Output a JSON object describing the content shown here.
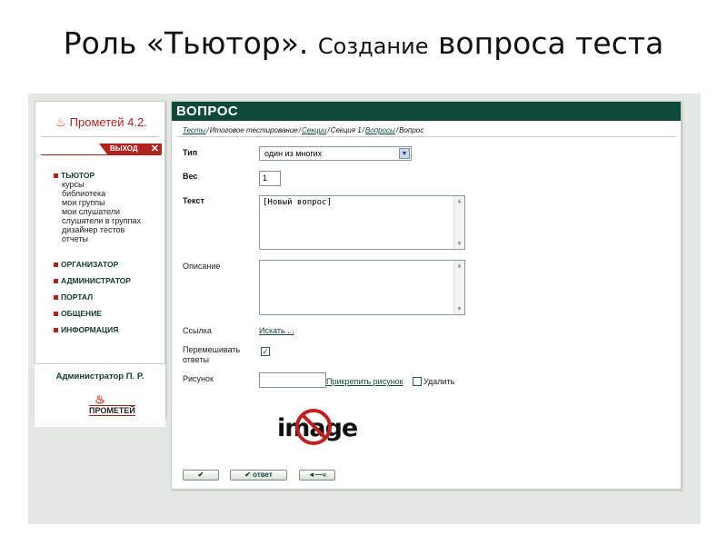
{
  "slide": {
    "title_main": "Роль «Тьютор». ",
    "title_mid": "Создание",
    "title_end": " вопроса теста"
  },
  "sidebar": {
    "logo_text": "Прометей 4.2.",
    "exit_label": "ВЫХОД",
    "exit_icon": "close-icon",
    "tutor_section": "ТЬЮТОР",
    "tutor_items": [
      "курсы",
      "библиотека",
      "мои группы",
      "мои слушатели",
      "слушатели в группах",
      "дизайнер тестов",
      "отчеты"
    ],
    "sections": [
      "ОРГАНИЗАТОР",
      "АДМИНИСТРАТОР",
      "ПОРТАЛ",
      "ОБЩЕНИЕ",
      "ИНФОРМАЦИЯ"
    ],
    "user_name": "Администратор П. Р.",
    "footer_logo": "ПРОМЕТЕЙ"
  },
  "panel": {
    "header": "ВОПРОС",
    "breadcrumb": {
      "link_tests": "Тесты",
      "text_final": "Итоговое тестирование",
      "link_sections": "Секции",
      "text_section": "Секция 1",
      "link_questions": "Вопросы",
      "text_question": "Вопрос",
      "separator": "/"
    },
    "form": {
      "type_label": "Тип",
      "type_value": "один из многих",
      "weight_label": "Вес",
      "weight_value": "1",
      "text_label": "Текст",
      "text_value": "[Новый вопрос]",
      "description_label": "Описание",
      "description_value": "",
      "link_label": "Ссылка",
      "link_search": "Искать ...",
      "shuffle_label_line1": "Перемешивать",
      "shuffle_label_line2": "ответы",
      "shuffle_checked": true,
      "image_label": "Рисунок",
      "attach_image": "Прикрепить рисунок",
      "delete_label": "Удалить",
      "image_placeholder_word": "image"
    },
    "buttons": {
      "ok_symbol": "✔",
      "answer_label": "ответ",
      "back_symbol": "◄—«"
    }
  }
}
